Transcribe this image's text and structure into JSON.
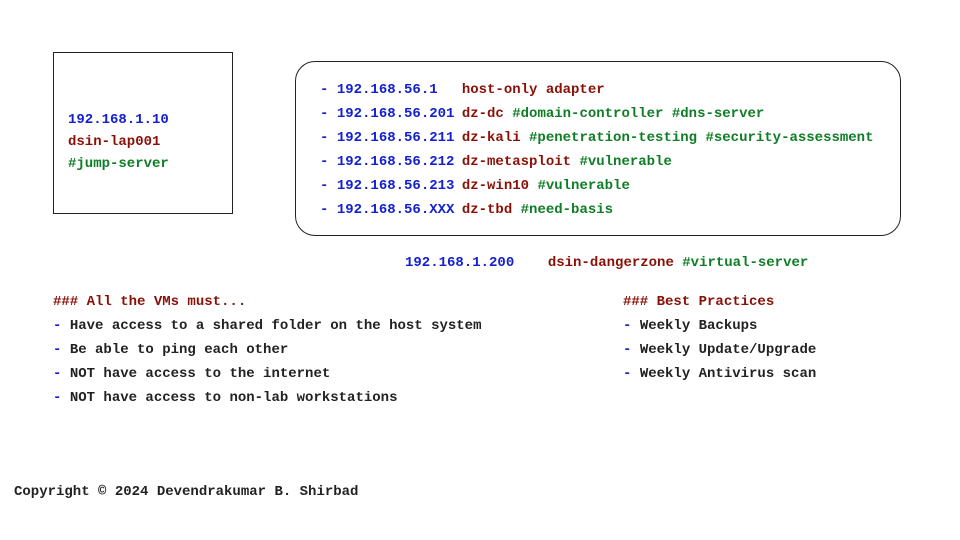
{
  "jump": {
    "ip": "192.168.1.10",
    "hostname": "dsin-lap001",
    "tag": "#jump-server"
  },
  "vms": [
    {
      "ip": "192.168.56.1",
      "hostname": "host-only adapter",
      "tags": ""
    },
    {
      "ip": "192.168.56.201",
      "hostname": "dz-dc",
      "tags": "#domain-controller #dns-server"
    },
    {
      "ip": "192.168.56.211",
      "hostname": "dz-kali",
      "tags": "#penetration-testing #security-assessment"
    },
    {
      "ip": "192.168.56.212",
      "hostname": "dz-metasploit",
      "tags": "#vulnerable"
    },
    {
      "ip": "192.168.56.213",
      "hostname": "dz-win10",
      "tags": "#vulnerable"
    },
    {
      "ip": "192.168.56.XXX",
      "hostname": "dz-tbd",
      "tags": "#need-basis"
    }
  ],
  "host": {
    "ip": "192.168.1.200",
    "hostname": "dsin-dangerzone",
    "tag": "#virtual-server"
  },
  "rules": {
    "heading": "### All the VMs must...",
    "items": [
      "Have access to a shared folder on the host system",
      "Be able to ping each other",
      "NOT have access to the internet",
      "NOT have access to non-lab workstations"
    ]
  },
  "practices": {
    "heading": "### Best Practices",
    "items": [
      "Weekly Backups",
      "Weekly Update/Upgrade",
      "Weekly Antivirus scan"
    ]
  },
  "bullet": "- ",
  "copyright": "Copyright © 2024 Devendrakumar B. Shirbad"
}
